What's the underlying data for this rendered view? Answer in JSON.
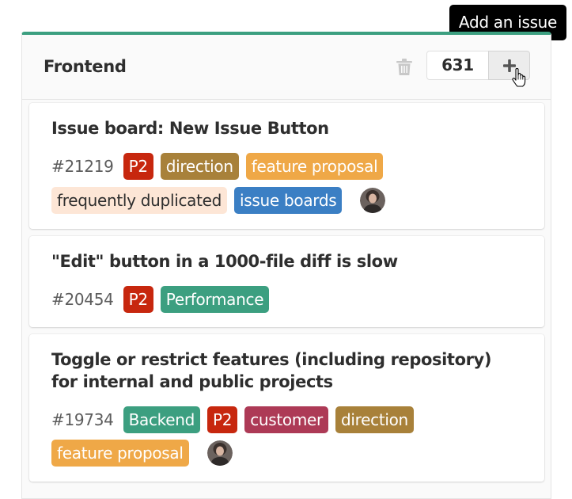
{
  "tooltip": {
    "text": "Add an issue"
  },
  "list": {
    "title": "Frontend",
    "issue_count": "631",
    "accent_color": "#3c9f80",
    "delete_icon": "trash-icon",
    "add_icon": "plus-icon"
  },
  "cards": [
    {
      "title": "Issue board: New Issue Button",
      "id": "#21219",
      "labels": [
        {
          "text": "P2",
          "color": "#c7270e",
          "text_color": "#ffffff"
        },
        {
          "text": "direction",
          "color": "#a8813a",
          "text_color": "#ffffff"
        },
        {
          "text": "feature proposal",
          "color": "#efa847",
          "text_color": "#ffffff"
        },
        {
          "text": "frequently duplicated",
          "color": "#fde6d6",
          "text_color": "#2e2e2e"
        },
        {
          "text": "issue boards",
          "color": "#3b7fc4",
          "text_color": "#ffffff"
        }
      ]
    },
    {
      "title": "\"Edit\" button in a 1000-file diff is slow",
      "id": "#20454",
      "labels": [
        {
          "text": "P2",
          "color": "#c7270e",
          "text_color": "#ffffff"
        },
        {
          "text": "Performance",
          "color": "#3c9f80",
          "text_color": "#ffffff"
        }
      ]
    },
    {
      "title": "Toggle or restrict features (including repository) for internal and public projects",
      "id": "#19734",
      "labels": [
        {
          "text": "Backend",
          "color": "#3c9f80",
          "text_color": "#ffffff"
        },
        {
          "text": "P2",
          "color": "#c7270e",
          "text_color": "#ffffff"
        },
        {
          "text": "customer",
          "color": "#ad3a56",
          "text_color": "#ffffff"
        },
        {
          "text": "direction",
          "color": "#a8813a",
          "text_color": "#ffffff"
        },
        {
          "text": "feature proposal",
          "color": "#efa847",
          "text_color": "#ffffff"
        }
      ]
    }
  ]
}
